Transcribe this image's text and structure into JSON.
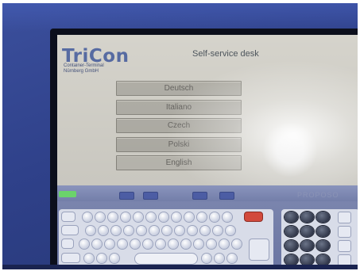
{
  "screen": {
    "logo_text": "TriCon",
    "logo_subtitle_line1": "Container-Terminal",
    "logo_subtitle_line2": "Nürnberg GmbH",
    "title": "Self-service desk"
  },
  "languages": [
    "Deutsch",
    "Italiano",
    "Czech",
    "Polski",
    "English"
  ],
  "keyboard": {
    "brand_text": "PROPOSO"
  },
  "colors": {
    "bezel_blue": "#2f418a",
    "screen_bg": "#dcdad2",
    "button_bg": "#b8b6ae",
    "accent_green": "#6bd36b",
    "accent_red": "#d24a3c"
  }
}
